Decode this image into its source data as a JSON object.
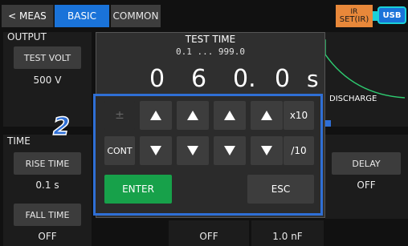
{
  "topbar": {
    "meas_tab": "< MEAS",
    "basic_tab": "BASIC",
    "common_tab": "COMMON",
    "ir_top": "IR",
    "ir_bottom": "SET(IR)",
    "usb_label": "USB"
  },
  "output": {
    "section": "OUTPUT",
    "test_volt_button": "TEST VOLT",
    "test_volt_value": "500 V"
  },
  "time": {
    "section": "TIME",
    "rise_time_button": "RISE TIME",
    "rise_time_value": "0.1 s",
    "fall_time_button": "FALL TIME",
    "fall_time_value": "OFF",
    "delay_button": "DELAY",
    "delay_value": "OFF",
    "bottom_value_1": "OFF",
    "bottom_value_2": "1.0 nF"
  },
  "graph": {
    "discharge_label": "DISCHARGE",
    "line_color": "#2ecc71"
  },
  "dialog": {
    "title": "TEST TIME",
    "range": "0.1 ... 999.0",
    "digits": [
      "0",
      "6",
      "0.",
      "0"
    ],
    "unit": "s"
  },
  "keypad": {
    "sign_key": "±",
    "cont_key": "CONT",
    "times10_key": "x10",
    "div10_key": "/10",
    "enter_key": "ENTER",
    "esc_key": "ESC",
    "up_icon": "triangle-up-icon",
    "down_icon": "triangle-down-icon"
  },
  "annotation": {
    "step_number": "2"
  },
  "colors": {
    "accent_blue": "#1a73d9",
    "highlight_blue": "#2f6fd6",
    "enter_green": "#17a14a",
    "ir_orange": "#e8883a",
    "usb_cyan": "#1ad0d8"
  }
}
